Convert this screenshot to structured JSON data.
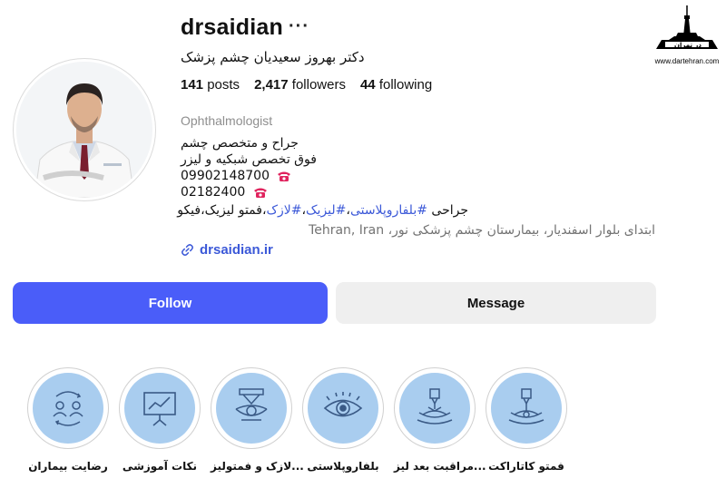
{
  "watermark": {
    "brand": "در تهران",
    "url": "www.dartehran.com"
  },
  "profile": {
    "username": "drsaidian",
    "more_icon": "more-horizontal-icon",
    "full_name": "دکتر بهروز سعیدیان چشم پزشک",
    "stats": {
      "posts_count": "141",
      "posts_label": "posts",
      "followers_count": "2,417",
      "followers_label": "followers",
      "following_count": "44",
      "following_label": "following"
    },
    "category": "Ophthalmologist",
    "bio": {
      "line1": "جراح و متخصص چشم",
      "line2": "فوق تخصص شبکیه و لیزر",
      "phone1": "09902148700",
      "phone2": "02182400",
      "phone_icon": "telephone-icon",
      "line5_prefix": "جراحی ",
      "hashtags": [
        "#بلفاروپلاستی",
        "#لیزیک",
        "#لازک"
      ],
      "line5_suffix": "،فمتو لیزیک،فیکو",
      "address": "ابتدای بلوار اسفندیار، بیمارستان چشم پزشکی نور، Tehran, Iran"
    },
    "link": "drsaidian.ir",
    "link_icon": "link-icon"
  },
  "actions": {
    "follow_label": "Follow",
    "message_label": "Message"
  },
  "highlights": [
    {
      "label": "فمتو کاتاراکت",
      "icon": "laser-eye-icon"
    },
    {
      "label": "مراقبت بعد لیز...",
      "icon": "laser-eye-icon"
    },
    {
      "label": "بلفاروپلاستی",
      "icon": "eye-icon"
    },
    {
      "label": "لازک و فمتولیز...",
      "icon": "laser-lens-icon"
    },
    {
      "label": "نکات آموزشی",
      "icon": "presentation-board-icon"
    },
    {
      "label": "رضایت بیماران",
      "icon": "patients-satisfaction-icon"
    }
  ],
  "colors": {
    "accent": "#4a5df9",
    "link": "#3c59d8",
    "highlight_bg": "#a9cdef",
    "icon_stroke": "#3a5a86"
  }
}
